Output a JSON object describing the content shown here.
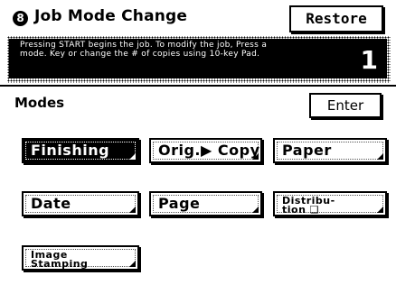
{
  "header": {
    "icon_text": "8",
    "title": "Job Mode Change",
    "restore_label": "Restore"
  },
  "info": {
    "message": "Pressing START begins the job. To modify the job, Press a mode. Key or change the # of copies using 10-key Pad.",
    "copies": "1"
  },
  "modes": {
    "label": "Modes",
    "enter_label": "Enter",
    "buttons": [
      {
        "label": "Finishing",
        "selected": true
      },
      {
        "label": "Orig.▶ Copy",
        "selected": false
      },
      {
        "label": "Paper",
        "selected": false
      },
      {
        "label": "Date",
        "selected": false
      },
      {
        "label": "Page",
        "selected": false
      },
      {
        "label": "Distribu-\ntion ❑",
        "selected": false
      },
      {
        "label": "Image\nStamping",
        "selected": false
      }
    ]
  },
  "colors": {
    "accent": "#000000",
    "background": "#ffffff"
  }
}
